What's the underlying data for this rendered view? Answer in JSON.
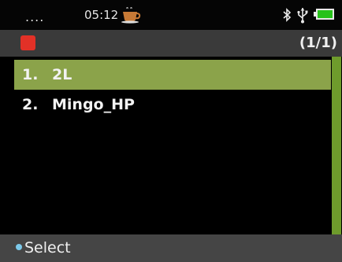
{
  "status": {
    "signal": "....",
    "time": "05:12",
    "icons": [
      "coffee-cup-icon",
      "bluetooth-icon",
      "usb-icon",
      "battery-icon"
    ],
    "battery_color": "#27c21a"
  },
  "title_bar": {
    "app_icon": "app-icon",
    "app_icon_color": "#e23127",
    "page_indicator": "(1/1)"
  },
  "list": {
    "items": [
      {
        "number": "1.",
        "label": "2L",
        "selected": true
      },
      {
        "number": "2.",
        "label": "Mingo_HP",
        "selected": false
      }
    ],
    "selected_color": "#8ba34a"
  },
  "softkeys": {
    "left": "Select"
  }
}
